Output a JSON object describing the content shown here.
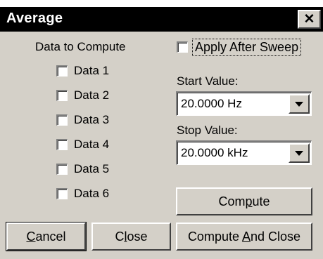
{
  "window": {
    "title": "Average",
    "close_glyph": "✕",
    "close_icon": "close-icon"
  },
  "data_section": {
    "heading": "Data to Compute",
    "items": [
      {
        "label": "Data 1",
        "checked": false
      },
      {
        "label": "Data 2",
        "checked": false
      },
      {
        "label": "Data 3",
        "checked": false
      },
      {
        "label": "Data 4",
        "checked": false
      },
      {
        "label": "Data 5",
        "checked": false
      },
      {
        "label": "Data 6",
        "checked": false
      }
    ]
  },
  "apply_after_sweep": {
    "label": "Apply After Sweep",
    "checked": false
  },
  "start_value": {
    "label": "Start Value:",
    "value": "20.0000  Hz",
    "arrow_icon": "chevron-down-icon"
  },
  "stop_value": {
    "label": "Stop Value:",
    "value": "20.0000 kHz",
    "arrow_icon": "chevron-down-icon"
  },
  "buttons": {
    "compute": {
      "pre": "Com",
      "mnemonic": "p",
      "post": "ute"
    },
    "cancel": {
      "pre": "",
      "mnemonic": "C",
      "post": "ancel"
    },
    "close": {
      "pre": "C",
      "mnemonic": "l",
      "post": "ose"
    },
    "compute_and_close": {
      "pre": "Compute ",
      "mnemonic": "A",
      "post": "nd Close"
    }
  }
}
